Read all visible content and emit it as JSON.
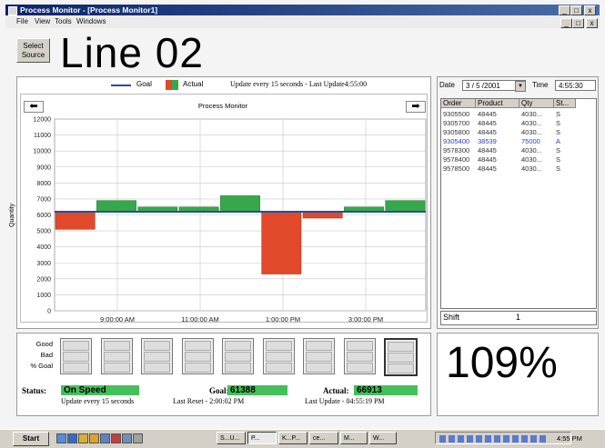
{
  "window": {
    "title": "Process Monitor - [Process Monitor1]",
    "controls": [
      "_",
      "□",
      "x"
    ],
    "mdi_controls": [
      "_",
      "□",
      "x"
    ]
  },
  "menubar": {
    "items": [
      "File",
      "View",
      "Tools",
      "Windows"
    ]
  },
  "header": {
    "select_source": "Select Source",
    "line_title": "Line 02"
  },
  "chart_legend": {
    "goal": "Goal",
    "actual": "Actual",
    "update_text": "Update every 15 seconds - Last Update4:55:00"
  },
  "colors": {
    "goal_line": "#2a4aa0",
    "above_goal": "#36a84a",
    "below_goal": "#e04a2a",
    "title_bar": "#0a246a"
  },
  "chart_data": {
    "type": "bar",
    "title": "Process Monitor",
    "ylabel": "Quantity",
    "xlabel": "",
    "ylim": [
      0,
      12000
    ],
    "yticks": [
      "0",
      "1000",
      "2000",
      "3000",
      "4000",
      "5000",
      "6000",
      "7000",
      "8000",
      "9000",
      "10000",
      "11000",
      "12000"
    ],
    "xticks": [
      "9:00:00 AM",
      "11:00:00 AM",
      "1:00:00 PM",
      "3:00:00 PM"
    ],
    "goal": 6200,
    "bars": [
      {
        "actual": 5100
      },
      {
        "actual": 6900
      },
      {
        "actual": 6500
      },
      {
        "actual": 6500
      },
      {
        "actual": 7200
      },
      {
        "actual": 2300
      },
      {
        "actual": 5800
      },
      {
        "actual": 6500
      },
      {
        "actual": 6900
      }
    ]
  },
  "date_time": {
    "date_label": "Date",
    "date_value": "3 / 5 /2001",
    "time_label": "Time",
    "time_value": "4:55:30"
  },
  "orders": {
    "columns": [
      "Order",
      "Product",
      "Qty",
      "St..."
    ],
    "rows": [
      [
        "9305500",
        "48445",
        "4030...",
        "S"
      ],
      [
        "9305700",
        "48445",
        "4030...",
        "S"
      ],
      [
        "9305800",
        "48445",
        "4030...",
        "S"
      ],
      [
        "9305400",
        "38539",
        "75000",
        "A"
      ],
      [
        "9578300",
        "48445",
        "4030...",
        "S"
      ],
      [
        "9578400",
        "48445",
        "4030...",
        "S"
      ],
      [
        "9578500",
        "48445",
        "4030...",
        "S"
      ]
    ]
  },
  "shift": {
    "label": "Shift",
    "value": "1"
  },
  "stats": {
    "row_labels": [
      "Good",
      "Bad",
      "% Goal"
    ],
    "status_label": "Status:",
    "status_value": "On Speed",
    "status_note": "Update every 15 seconds",
    "goal_label": "Goal:",
    "goal_value": "61388",
    "goal_note": "Last Reset - 2:00:02 PM",
    "actual_label": "Actual:",
    "actual_value": "66913",
    "actual_note": "Last Update - 04:55:19 PM"
  },
  "percent": "109%",
  "taskbar": {
    "start": "Start",
    "buttons": [
      "S...U...",
      "P...",
      "K...P...",
      "ce...",
      "M...",
      "W..."
    ],
    "clock": "4:55 PM"
  }
}
